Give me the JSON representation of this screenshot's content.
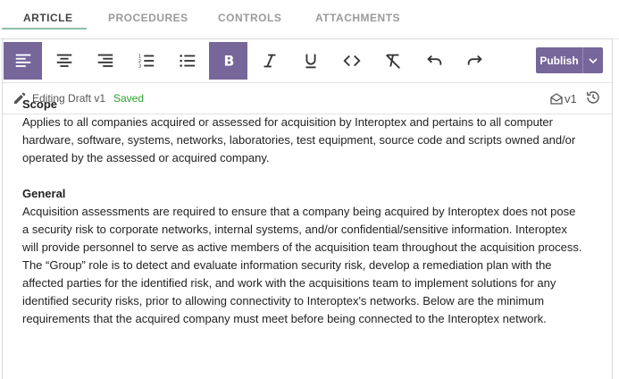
{
  "tabs": [
    {
      "label": "ARTICLE",
      "active": true
    },
    {
      "label": "PROCEDURES",
      "active": false
    },
    {
      "label": "CONTROLS",
      "active": false
    },
    {
      "label": "ATTACHMENTS",
      "active": false
    }
  ],
  "toolbar": {
    "buttons": [
      {
        "icon": "align-left-icon",
        "active": true
      },
      {
        "icon": "align-center-icon",
        "active": false
      },
      {
        "icon": "align-right-icon",
        "active": false
      },
      {
        "icon": "ordered-list-icon",
        "active": false
      },
      {
        "icon": "bullet-list-icon",
        "active": false
      },
      {
        "icon": "bold-icon",
        "active": true
      },
      {
        "icon": "italic-icon",
        "active": false
      },
      {
        "icon": "underline-icon",
        "active": false
      },
      {
        "icon": "code-icon",
        "active": false
      },
      {
        "icon": "clear-format-icon",
        "active": false
      },
      {
        "icon": "undo-icon",
        "active": false
      },
      {
        "icon": "redo-icon",
        "active": false
      }
    ],
    "publish_label": "Publish"
  },
  "status": {
    "editing_label": "Editing Draft v1",
    "saved_label": "Saved",
    "version_label": "v1"
  },
  "content": {
    "sections": [
      {
        "title": "Scope",
        "body": "Applies to all companies acquired or assessed for acquisition by Interoptex and pertains to all computer hardware, software, systems, networks, laboratories, test equipment, source code and scripts owned and/or operated by the assessed or acquired company."
      },
      {
        "title": "General",
        "body": "Acquisition assessments are required to ensure that a company being acquired by Interoptex does not pose a security risk to corporate networks, internal systems, and/or confidential/sensitive information. Interoptex will provide personnel to serve as active members of the acquisition team throughout the acquisition process. The “Group” role is to detect and evaluate information security risk, develop a remediation plan with the affected parties for the identified risk, and work with the acquisitions team to implement solutions for any identified security risks, prior to allowing connectivity to Interoptex's networks. Below are the minimum requirements that the acquired company must meet before being connected to the Interoptex network."
      }
    ]
  },
  "colors": {
    "accent": "#76669a",
    "tab_underline": "#8fc1a9",
    "saved": "#2fa12f"
  }
}
